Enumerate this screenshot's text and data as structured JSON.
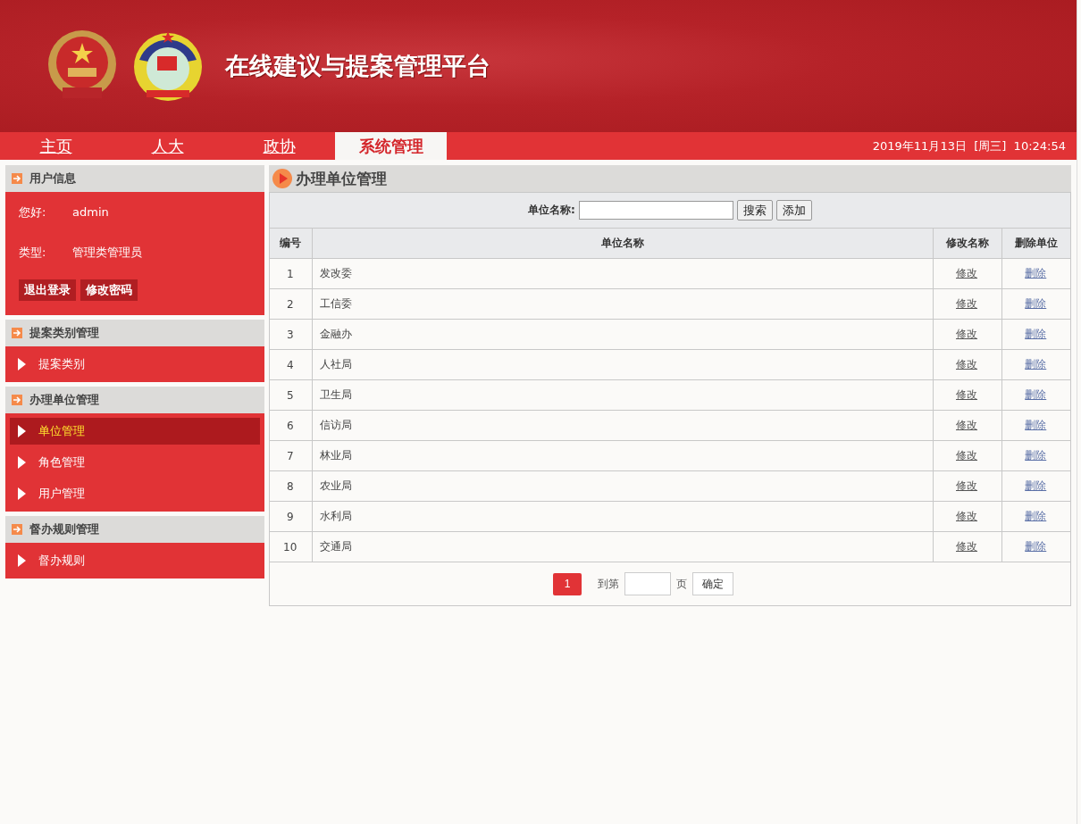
{
  "header": {
    "title": "在线建议与提案管理平台"
  },
  "nav": {
    "tabs": [
      {
        "label": "主页",
        "selected": false
      },
      {
        "label": "人大",
        "selected": false
      },
      {
        "label": "政协",
        "selected": false
      },
      {
        "label": "系统管理",
        "selected": true
      }
    ],
    "datetime": "2019年11月13日  [周三]  10:24:54"
  },
  "sidebar": {
    "user_panel": {
      "title": "用户信息",
      "greeting_label": "您好:",
      "username": "admin",
      "type_label": "类型:",
      "type_value": "管理类管理员",
      "buttons": [
        "退出登录",
        "修改密码"
      ]
    },
    "sections": [
      {
        "title": "提案类别管理",
        "items": [
          {
            "label": "提案类别",
            "selected": false
          }
        ]
      },
      {
        "title": "办理单位管理",
        "items": [
          {
            "label": "单位管理",
            "selected": true
          },
          {
            "label": "角色管理",
            "selected": false
          },
          {
            "label": "用户管理",
            "selected": false
          }
        ]
      },
      {
        "title": "督办规则管理",
        "items": [
          {
            "label": "督办规则",
            "selected": false
          }
        ]
      }
    ]
  },
  "main": {
    "title": "办理单位管理",
    "search": {
      "label": "单位名称:",
      "buttons": [
        "搜索",
        "添加"
      ]
    },
    "table": {
      "columns": [
        "编号",
        "单位名称",
        "修改名称",
        "删除单位"
      ],
      "rows": [
        {
          "number": "1",
          "name": "发改委",
          "edit": "修改",
          "delete": "删除"
        },
        {
          "number": "2",
          "name": "工信委",
          "edit": "修改",
          "delete": "删除"
        },
        {
          "number": "3",
          "name": "金融办",
          "edit": "修改",
          "delete": "删除"
        },
        {
          "number": "4",
          "name": "人社局",
          "edit": "修改",
          "delete": "删除"
        },
        {
          "number": "5",
          "name": "卫生局",
          "edit": "修改",
          "delete": "删除"
        },
        {
          "number": "6",
          "name": "信访局",
          "edit": "修改",
          "delete": "删除"
        },
        {
          "number": "7",
          "name": "林业局",
          "edit": "修改",
          "delete": "删除"
        },
        {
          "number": "8",
          "name": "农业局",
          "edit": "修改",
          "delete": "删除"
        },
        {
          "number": "9",
          "name": "水利局",
          "edit": "修改",
          "delete": "删除"
        },
        {
          "number": "10",
          "name": "交通局",
          "edit": "修改",
          "delete": "删除"
        }
      ]
    },
    "pagination": {
      "current_page": "1",
      "goto_label": "到第",
      "page_suffix": "页",
      "confirm": "确定"
    }
  }
}
